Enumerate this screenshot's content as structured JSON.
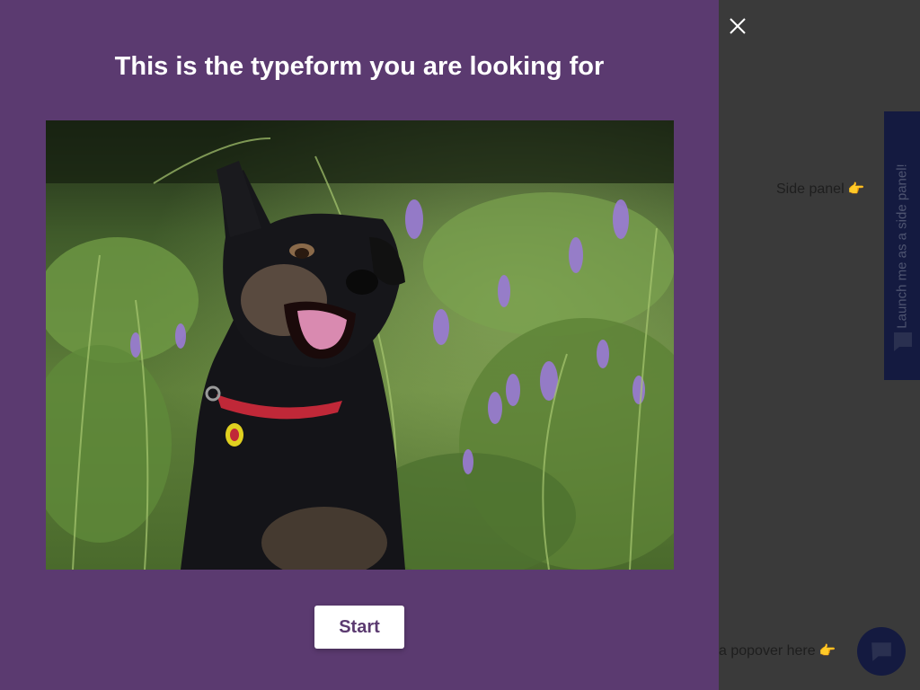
{
  "panel": {
    "title": "This is the typeform you are looking for",
    "start_label": "Start",
    "background_color": "#5b3a70",
    "button_text_color": "#5b3a70",
    "image_subject": "dog-in-wildflower-meadow"
  },
  "close": {
    "icon": "close-icon"
  },
  "background_page": {
    "side_panel_label": "Side panel",
    "side_panel_emoji": "👉",
    "side_tab_label": "Launch me as a side panel!",
    "side_tab_icon": "chat-bubble-icon",
    "popover_label": "a popover here",
    "popover_emoji": "👉",
    "popover_icon": "chat-bubble-icon",
    "accent_color": "#141a40"
  }
}
